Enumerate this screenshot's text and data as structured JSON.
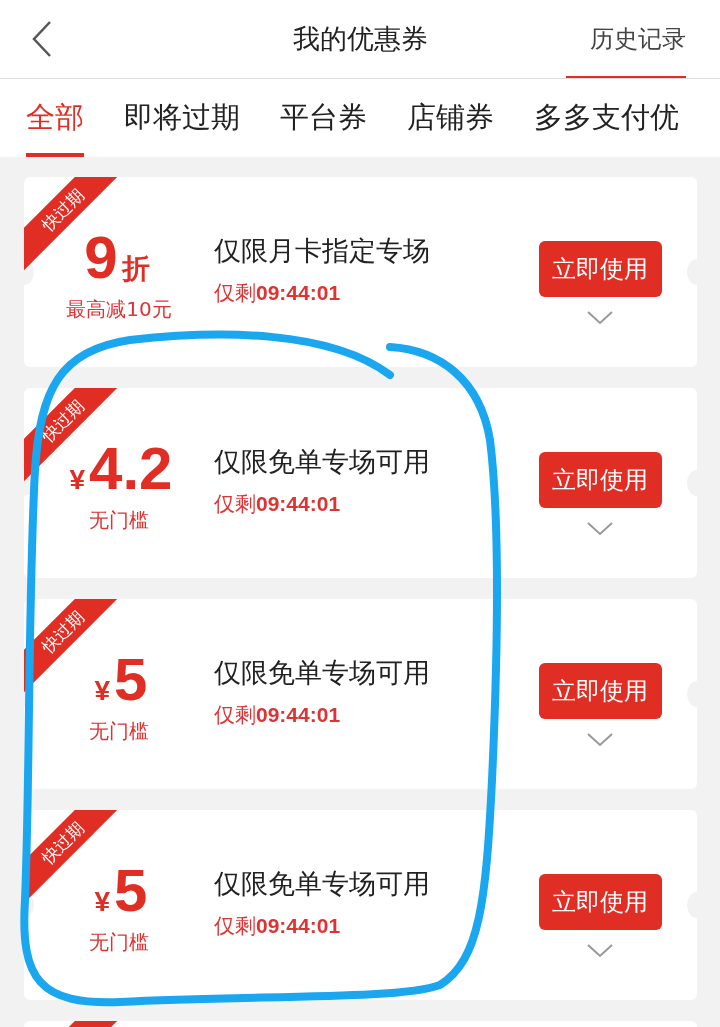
{
  "header": {
    "title": "我的优惠券",
    "history_link": "历史记录"
  },
  "tabs": [
    {
      "label": "全部",
      "selected": true
    },
    {
      "label": "即将过期",
      "selected": false
    },
    {
      "label": "平台券",
      "selected": false
    },
    {
      "label": "店铺券",
      "selected": false
    },
    {
      "label": "多多支付优",
      "selected": false
    }
  ],
  "coupons": [
    {
      "badge": "快过期",
      "kind": "discount",
      "value": "9",
      "unit": "折",
      "condition": "最高减10元",
      "title": "仅限月卡指定专场",
      "countdown": "仅剩**09:44:01**",
      "button": "立即使用"
    },
    {
      "badge": "快过期",
      "kind": "cash",
      "unit": "¥",
      "value": "4.2",
      "condition": "无门槛",
      "title": "仅限免单专场可用",
      "countdown": "仅剩**09:44:01**",
      "button": "立即使用"
    },
    {
      "badge": "快过期",
      "kind": "cash",
      "unit": "¥",
      "value": "5",
      "condition": "无门槛",
      "title": "仅限免单专场可用",
      "countdown": "仅剩**09:44:01**",
      "button": "立即使用"
    },
    {
      "badge": "快过期",
      "kind": "cash",
      "unit": "¥",
      "value": "5",
      "condition": "无门槛",
      "title": "仅限免单专场可用",
      "countdown": "仅剩**09:44:01**",
      "button": "立即使用"
    }
  ]
}
